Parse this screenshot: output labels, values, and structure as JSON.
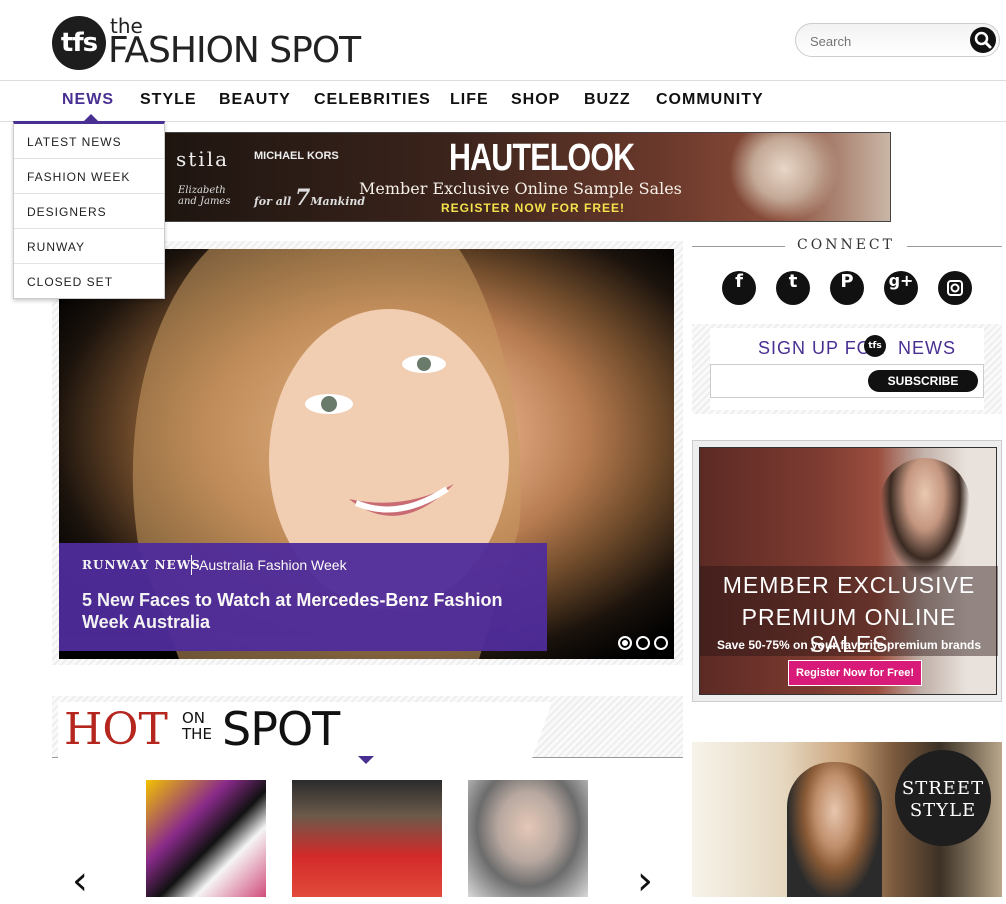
{
  "header": {
    "logo_badge": "tfs",
    "logo_the": "the",
    "logo_name": "FASHION SPOT",
    "search": {
      "placeholder": "Search"
    }
  },
  "nav": {
    "items": [
      "NEWS",
      "STYLE",
      "BEAUTY",
      "CELEBRITIES",
      "LIFE",
      "SHOP",
      "BUZZ",
      "COMMUNITY"
    ],
    "active": "NEWS",
    "dropdown": [
      "LATEST NEWS",
      "FASHION WEEK",
      "DESIGNERS",
      "RUNWAY",
      "CLOSED SET"
    ]
  },
  "banner_ad": {
    "brand1": "stila",
    "brand2": "MICHAEL KORS",
    "brand3": "Elizabeth and James",
    "brand4": "7 for all Mankind",
    "title": "HAUTELOOK",
    "subtitle": "Member Exclusive Online Sample Sales",
    "cta": "REGISTER NOW FOR FREE!"
  },
  "hero": {
    "category": "RUNWAY NEWS",
    "subcategory": "Australia Fashion Week",
    "headline": "5 New Faces to Watch at Mercedes-Benz Fashion Week Australia",
    "slides": 3,
    "active_slide": 1
  },
  "sidebar": {
    "connect_label": "CONNECT",
    "social": [
      "facebook-icon",
      "twitter-icon",
      "pinterest-icon",
      "google-plus-icon",
      "instagram-icon"
    ],
    "signup_left": "SIGN UP FOR",
    "signup_badge": "tfs",
    "signup_right": "NEWS",
    "subscribe_label": "SUBSCRIBE",
    "ad": {
      "line1": "MEMBER EXCLUSIVE",
      "line2": "PREMIUM ONLINE SALES",
      "line3": "Save 50-75% on your favorite premium brands",
      "cta": "Register Now for Free!"
    },
    "street_style": "STREET STYLE"
  },
  "hot_on_the_spot": {
    "hot": "HOT",
    "on": "ON",
    "the": "THE",
    "spot": "SPOT",
    "prev": "‹",
    "next": "›"
  },
  "colors": {
    "accent": "#4a2f92",
    "hot_red": "#b5261e",
    "ad_pink": "#d81b79",
    "banner_yellow": "#f4e14c"
  }
}
